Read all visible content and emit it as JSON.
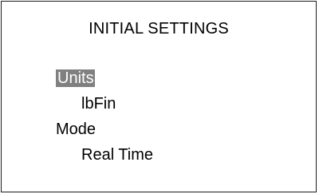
{
  "screen": {
    "title": "INITIAL SETTINGS"
  },
  "settings": [
    {
      "label": "Units",
      "value": "lbFin",
      "selected": true
    },
    {
      "label": "Mode",
      "value": "Real Time",
      "selected": false
    }
  ],
  "colors": {
    "selection_background": "#808080",
    "selection_text": "#ffffff",
    "text": "#000000",
    "frame": "#1a1a1a"
  }
}
